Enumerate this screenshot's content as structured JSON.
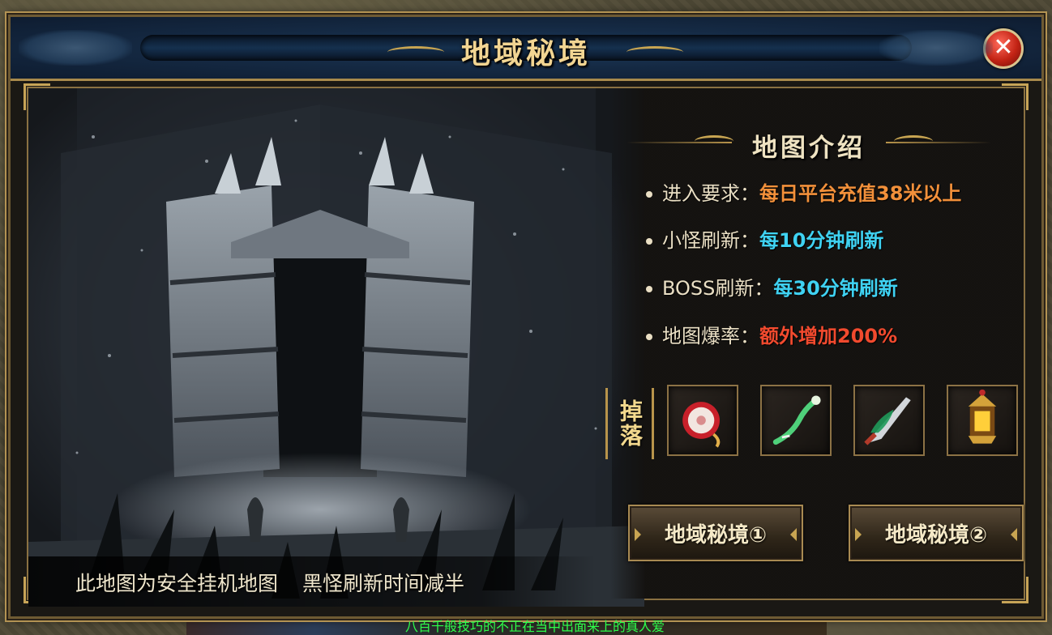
{
  "window": {
    "title": "地域秘境",
    "close_icon": "close-x-icon"
  },
  "scene": {
    "caption_left": "此地图为安全挂机地图",
    "caption_right": "黑怪刷新时间减半"
  },
  "intro": {
    "heading": "地图介绍",
    "rows": [
      {
        "label": "进入要求：",
        "value": "每日平台充值38米以上",
        "color": "#f2903a"
      },
      {
        "label": "小怪刷新：",
        "value": "每10分钟刷新",
        "color": "#3fd2f2"
      },
      {
        "label": "BOSS刷新：",
        "value": "每30分钟刷新",
        "color": "#3fd2f2"
      },
      {
        "label": "地图爆率：",
        "value": "额外增加200%",
        "color": "#f24a2e"
      }
    ]
  },
  "drops": {
    "label": "掉落",
    "items": [
      {
        "icon": "red-amulet-icon"
      },
      {
        "icon": "jade-staff-icon"
      },
      {
        "icon": "green-blade-icon"
      },
      {
        "icon": "golden-lantern-icon"
      }
    ]
  },
  "buttons": {
    "map1": "地域秘境①",
    "map2": "地域秘境②"
  },
  "ticker": {
    "text": "八百千般技巧的不正在当中出面来上的真人爱"
  }
}
